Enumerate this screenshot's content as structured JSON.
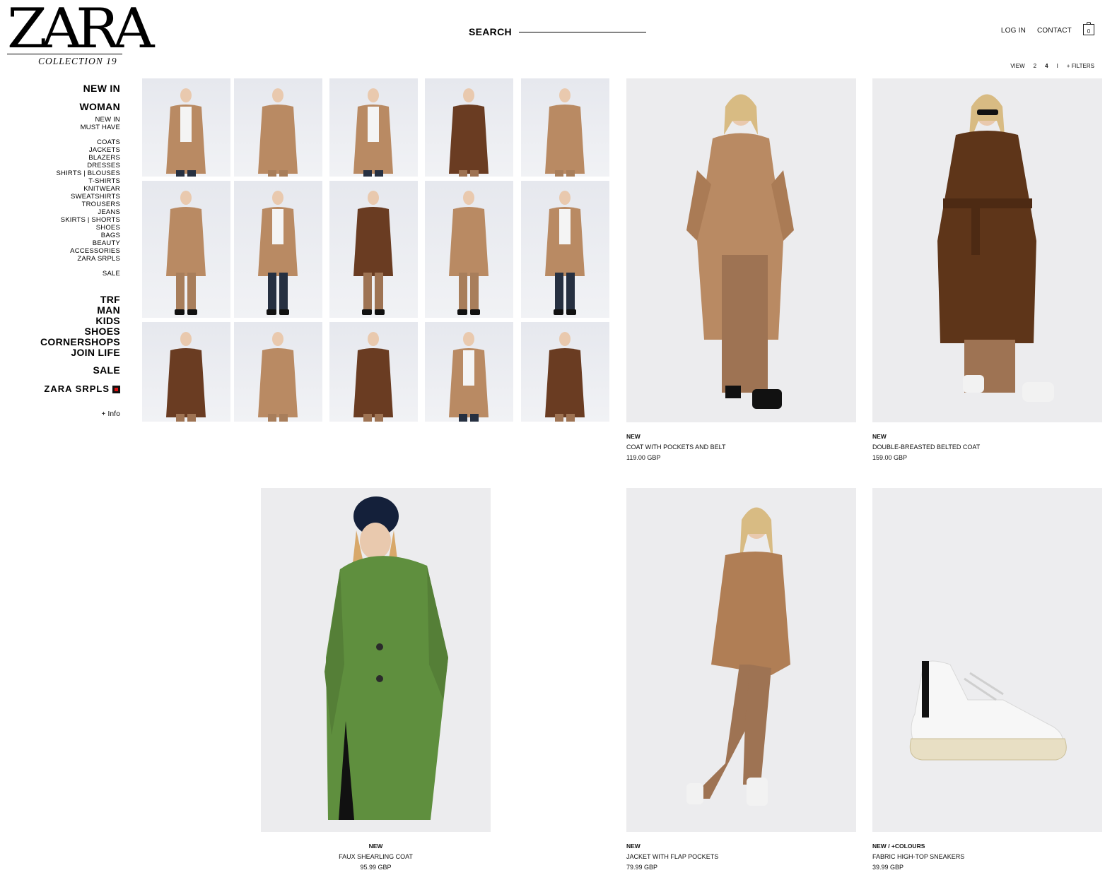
{
  "brand": {
    "logo_text": "ZARA",
    "collection": "COLLECTION 19"
  },
  "search": {
    "label": "SEARCH"
  },
  "topnav": {
    "login": "LOG IN",
    "contact": "CONTACT",
    "cart_count": "0"
  },
  "view": {
    "label": "VIEW",
    "options": [
      "2",
      "4",
      "I"
    ],
    "active": "4",
    "filters": "+ FILTERS"
  },
  "sidebar": {
    "new_in": "NEW IN",
    "woman": "WOMAN",
    "woman_top": [
      "NEW IN",
      "MUST HAVE"
    ],
    "categories": [
      "COATS",
      "JACKETS",
      "BLAZERS",
      "DRESSES",
      "SHIRTS | BLOUSES",
      "T-SHIRTS",
      "KNITWEAR",
      "SWEATSHIRTS",
      "TROUSERS",
      "JEANS",
      "SKIRTS | SHORTS",
      "SHOES",
      "BAGS",
      "BEAUTY",
      "ACCESSORIES",
      "ZARA SRPLS"
    ],
    "sale_small": "SALE",
    "sections": [
      "TRF",
      "MAN",
      "KIDS",
      "SHOES",
      "CORNERSHOPS",
      "JOIN LIFE"
    ],
    "sale": "SALE",
    "srpls": "ZARA SRPLS",
    "info": "+ Info"
  },
  "colors": {
    "camel": "#b98a63",
    "brown": "#6a3c22",
    "green": "#5f8f3e",
    "denim": "#263041",
    "bg": "#ececee"
  },
  "products": [
    {
      "tag": "NEW",
      "name": "COAT WITH POCKETS AND BELT",
      "price": "119.00 GBP"
    },
    {
      "tag": "NEW",
      "name": "DOUBLE-BREASTED BELTED COAT",
      "price": "159.00 GBP"
    },
    {
      "tag": "NEW",
      "name": "FAUX SHEARLING COAT",
      "price": "95.99 GBP"
    },
    {
      "tag": "NEW",
      "name": "JACKET WITH FLAP POCKETS",
      "price": "79.99 GBP"
    },
    {
      "tag": "NEW / +COLOURS",
      "name": "FABRIC HIGH-TOP SNEAKERS",
      "price": "39.99 GBP"
    }
  ]
}
